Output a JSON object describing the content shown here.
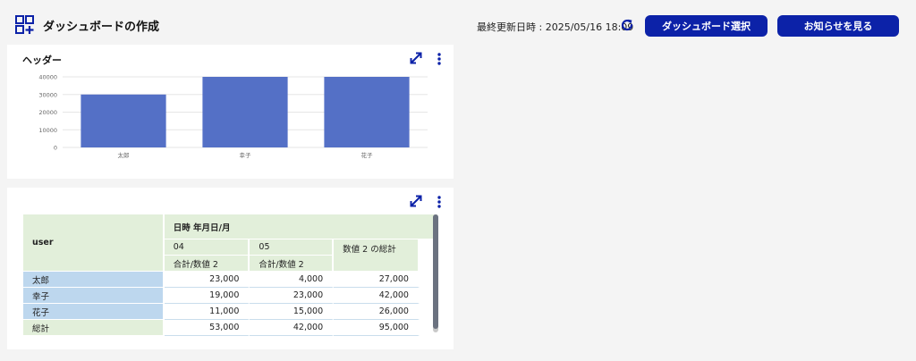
{
  "header": {
    "title": "ダッシュボードの作成",
    "last_updated": "最終更新日時 : 2025/05/16 18:09",
    "dashboard_select_label": "ダッシュボード選択",
    "notices_label": "お知らせを見る"
  },
  "chart_panel": {
    "title": "ヘッダー",
    "chart_data": {
      "type": "bar",
      "categories": [
        "太郎",
        "幸子",
        "花子"
      ],
      "values": [
        30000,
        40000,
        40000
      ],
      "ylim": [
        0,
        40000
      ],
      "yticks": [
        0,
        10000,
        20000,
        30000,
        40000
      ],
      "grid": true,
      "bar_color": "#5470c6"
    }
  },
  "table_panel": {
    "headers": {
      "user": "user",
      "date": "日時 年月日/月",
      "month1": "04",
      "month2": "05",
      "measure1": "合計/数値 2",
      "measure2": "合計/数値 2",
      "grand_total": "数値 2 の総計"
    },
    "rows": [
      {
        "label": "太郎",
        "c1": "23,000",
        "c2": "4,000",
        "total": "27,000"
      },
      {
        "label": "幸子",
        "c1": "19,000",
        "c2": "23,000",
        "total": "42,000"
      },
      {
        "label": "花子",
        "c1": "11,000",
        "c2": "15,000",
        "total": "26,000"
      },
      {
        "label": "総計",
        "c1": "53,000",
        "c2": "42,000",
        "total": "95,000"
      }
    ]
  },
  "colors": {
    "accent": "#0c22a8",
    "header_green": "#e2efda",
    "row_blue": "#bdd7ee"
  }
}
